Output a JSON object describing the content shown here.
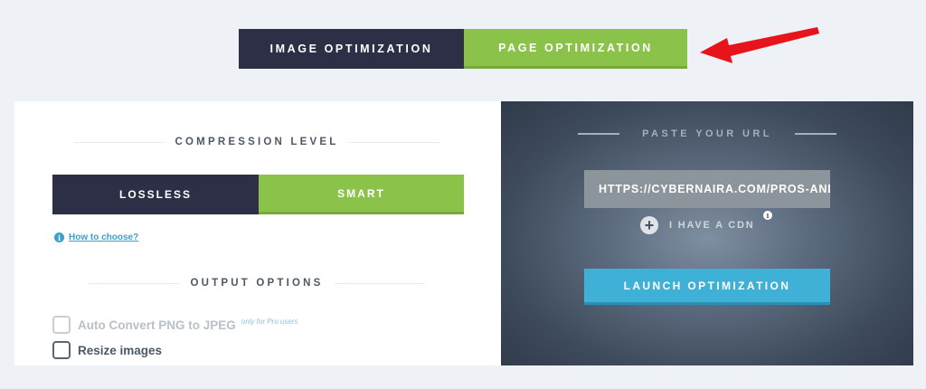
{
  "tabs": {
    "image_optimization": "IMAGE OPTIMIZATION",
    "page_optimization": "PAGE OPTIMIZATION"
  },
  "compression": {
    "title": "COMPRESSION LEVEL",
    "lossless": "LOSSLESS",
    "smart": "SMART",
    "selected": "SMART"
  },
  "help": {
    "how_to_choose": "How to choose?"
  },
  "output": {
    "title": "OUTPUT OPTIONS",
    "auto_convert": "Auto Convert PNG to JPEG",
    "pro_note": "only for Pro users",
    "resize": "Resize images"
  },
  "url_panel": {
    "title": "PASTE YOUR URL",
    "url_value": "HTTPS://CYBERNAIRA.COM/PROS-AND-CONS-OF-BUYING-A-HOUSE/",
    "cdn_label": "I HAVE A CDN",
    "launch": "LAUNCH OPTIMIZATION"
  },
  "colors": {
    "dark": "#2c2f45",
    "green": "#8bc34a",
    "blue": "#3fb0d6",
    "arrow": "#e8141c"
  },
  "icons": {
    "info": "info-icon",
    "plus": "plus-circle-icon",
    "arrow": "red-arrow-icon"
  }
}
